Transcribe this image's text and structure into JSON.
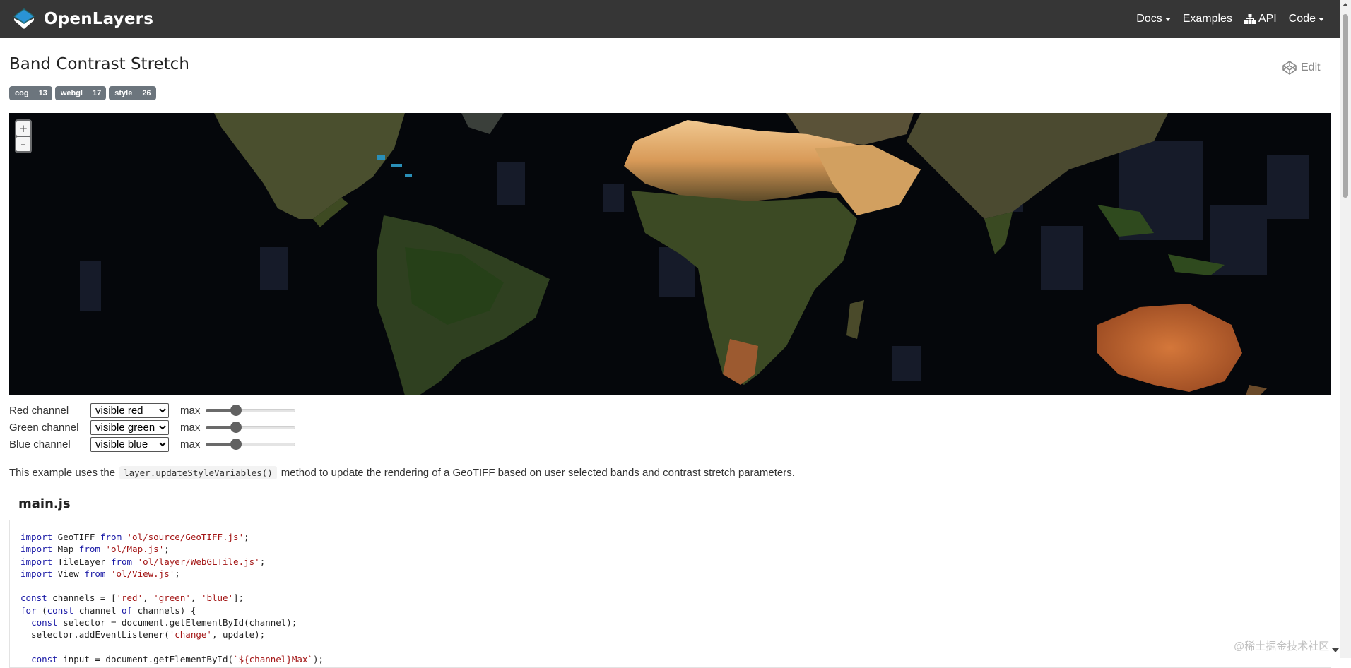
{
  "navbar": {
    "brand": "OpenLayers",
    "links": [
      {
        "label": "Docs",
        "caret": true,
        "icon": ""
      },
      {
        "label": "Examples",
        "caret": false,
        "icon": ""
      },
      {
        "label": "API",
        "caret": false,
        "icon": "sitemap-icon"
      },
      {
        "label": "Code",
        "caret": true,
        "icon": ""
      }
    ]
  },
  "page": {
    "title": "Band Contrast Stretch",
    "edit_label": "Edit",
    "tags": [
      {
        "name": "cog",
        "count": "13"
      },
      {
        "name": "webgl",
        "count": "17"
      },
      {
        "name": "style",
        "count": "26"
      }
    ]
  },
  "map": {
    "zoom_in": "+",
    "zoom_out": "–"
  },
  "controls": [
    {
      "label": "Red channel",
      "selected": "visible red",
      "max_label": "max",
      "slider_fraction": 0.31
    },
    {
      "label": "Green channel",
      "selected": "visible green",
      "max_label": "max",
      "slider_fraction": 0.31
    },
    {
      "label": "Blue channel",
      "selected": "visible blue",
      "max_label": "max",
      "slider_fraction": 0.31
    }
  ],
  "description": {
    "before": "This example uses the",
    "code": "layer.updateStyleVariables()",
    "after": "method to update the rendering of a GeoTIFF based on user selected bands and contrast stretch parameters."
  },
  "source": {
    "filename": "main.js",
    "lines": [
      "import GeoTIFF from 'ol/source/GeoTIFF.js';",
      "import Map from 'ol/Map.js';",
      "import TileLayer from 'ol/layer/WebGLTile.js';",
      "import View from 'ol/View.js';",
      "",
      "const channels = ['red', 'green', 'blue'];",
      "for (const channel of channels) {",
      "  const selector = document.getElementById(channel);",
      "  selector.addEventListener('change', update);",
      "",
      "  const input = document.getElementById(`${channel}Max`);"
    ]
  },
  "watermark": "@稀土掘金技术社区",
  "colors": {
    "navbar_bg": "#363636",
    "map_ocean": "#05070b",
    "keyword": "#1a1aa6",
    "string": "#a31515"
  }
}
